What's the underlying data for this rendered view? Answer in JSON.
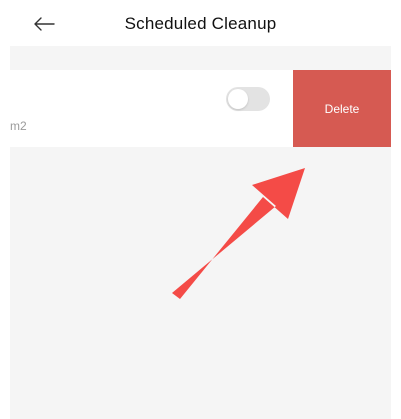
{
  "header": {
    "back_icon": "arrow-left-icon",
    "title": "Scheduled Cleanup"
  },
  "item": {
    "subtext": "m2",
    "toggle_on": false
  },
  "actions": {
    "delete_label": "Delete"
  },
  "colors": {
    "delete_bg": "#d65a52",
    "content_bg": "#f5f5f5",
    "annotation_arrow": "#f44b47"
  }
}
